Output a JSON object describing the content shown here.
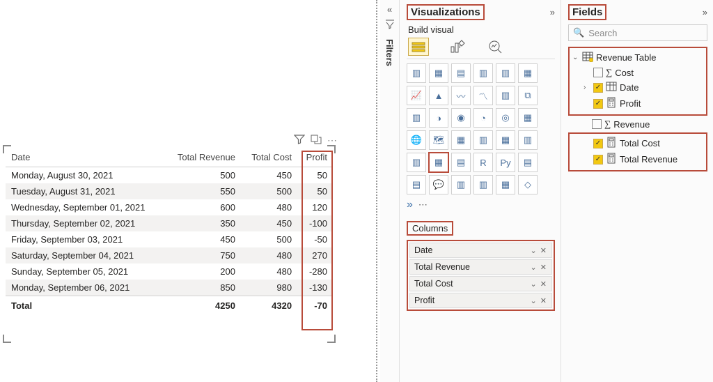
{
  "canvas": {
    "table": {
      "headers": [
        "Date",
        "Total Revenue",
        "Total Cost",
        "Profit"
      ],
      "rows": [
        {
          "date": "Monday, August 30, 2021",
          "rev": "500",
          "cost": "450",
          "profit": "50"
        },
        {
          "date": "Tuesday, August 31, 2021",
          "rev": "550",
          "cost": "500",
          "profit": "50"
        },
        {
          "date": "Wednesday, September 01, 2021",
          "rev": "600",
          "cost": "480",
          "profit": "120"
        },
        {
          "date": "Thursday, September 02, 2021",
          "rev": "350",
          "cost": "450",
          "profit": "-100"
        },
        {
          "date": "Friday, September 03, 2021",
          "rev": "450",
          "cost": "500",
          "profit": "-50"
        },
        {
          "date": "Saturday, September 04, 2021",
          "rev": "750",
          "cost": "480",
          "profit": "270"
        },
        {
          "date": "Sunday, September 05, 2021",
          "rev": "200",
          "cost": "480",
          "profit": "-280"
        },
        {
          "date": "Monday, September 06, 2021",
          "rev": "850",
          "cost": "980",
          "profit": "-130"
        }
      ],
      "total_label": "Total",
      "totals": {
        "rev": "4250",
        "cost": "4320",
        "profit": "-70"
      }
    },
    "toolbar": {
      "filter": "filter",
      "focus": "focus",
      "more": "⋯"
    }
  },
  "filters": {
    "label": "Filters"
  },
  "viz": {
    "title": "Visualizations",
    "sub_title": "Build visual",
    "columns_label": "Columns",
    "wells": [
      "Date",
      "Total Revenue",
      "Total Cost",
      "Profit"
    ],
    "icons": [
      "▥",
      "▦",
      "▤",
      "▥",
      "▥",
      "▦",
      "📈",
      "▲",
      "〰",
      "〽",
      "▥",
      "⧉",
      "▥",
      "◑",
      "◉",
      "◔",
      "◎",
      "▦",
      "🌐",
      "🗺",
      "▦",
      "▥",
      "▦",
      "▥",
      "▥",
      "▦",
      "▤",
      "R",
      "Py",
      "▤",
      "▤",
      "💬",
      "▥",
      "▥",
      "▦",
      "◇"
    ],
    "extra": "»"
  },
  "fields": {
    "title": "Fields",
    "search_placeholder": "Search",
    "table_name": "Revenue Table",
    "items": [
      {
        "label": "Cost",
        "checked": false,
        "icon": "sigma"
      },
      {
        "label": "Date",
        "checked": true,
        "icon": "table",
        "expandable": true
      },
      {
        "label": "Profit",
        "checked": true,
        "icon": "calc"
      },
      {
        "label": "Revenue",
        "checked": false,
        "icon": "sigma"
      },
      {
        "label": "Total Cost",
        "checked": true,
        "icon": "calc"
      },
      {
        "label": "Total Revenue",
        "checked": true,
        "icon": "calc"
      }
    ]
  }
}
